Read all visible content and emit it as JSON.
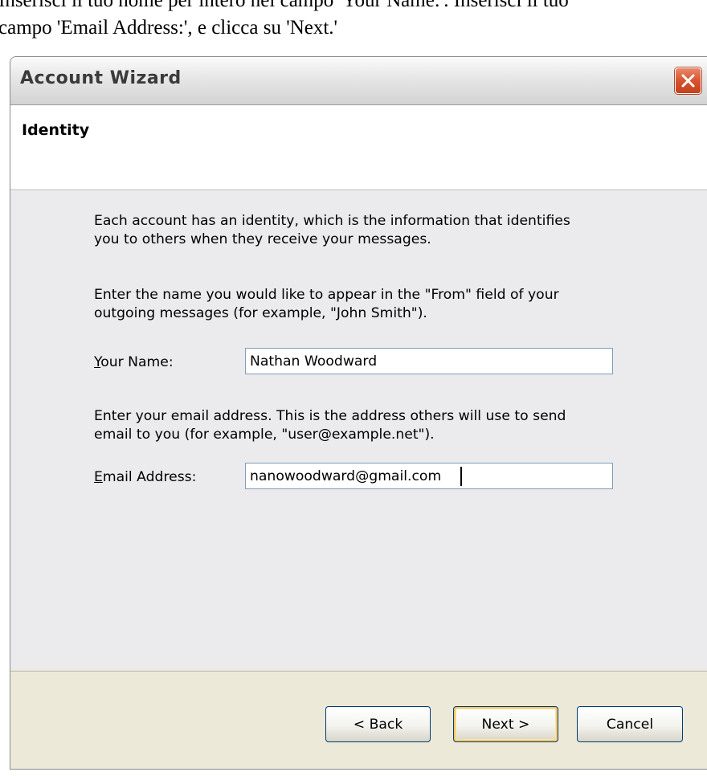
{
  "instruction": {
    "line1": "Inserisci il tuo nome per intero nel campo 'Your Name:'. Inserisci il tuo",
    "line2": "campo 'Email Address:', e clicca su 'Next.'"
  },
  "window": {
    "title": "Account Wizard",
    "close_icon": "close-icon",
    "accent_color": "#d8532e"
  },
  "page": {
    "heading": "Identity"
  },
  "content": {
    "intro_line1": "Each account has an identity, which is the information that identifies",
    "intro_line2": "you to others when they receive your messages.",
    "name_help_line1": "Enter the name you would like to appear in the \"From\" field of your",
    "name_help_line2": "outgoing messages (for example, \"John Smith\").",
    "name_label_accel": "Y",
    "name_label_rest": "our Name:",
    "name_value": "Nathan Woodward",
    "email_help_line1": "Enter your email address. This is the address others will use to send",
    "email_help_line2": "email to you (for example, \"user@example.net\").",
    "email_label_accel": "E",
    "email_label_rest": "mail Address:",
    "email_value": "nanowoodward@gmail.com"
  },
  "buttons": {
    "back": "< Back",
    "next": "Next >",
    "cancel": "Cancel"
  }
}
